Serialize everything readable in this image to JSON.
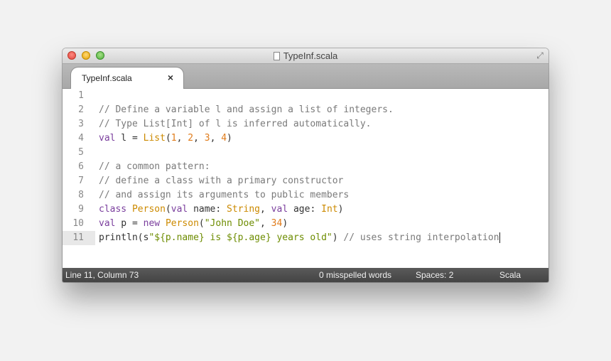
{
  "window": {
    "title": "TypeInf.scala"
  },
  "tab": {
    "label": "TypeInf.scala",
    "close_glyph": "×"
  },
  "editor": {
    "active_line": 11,
    "lines": [
      {
        "num": "1",
        "tokens": []
      },
      {
        "num": "2",
        "tokens": [
          {
            "t": "cm",
            "v": "// Define a variable l and assign a list of integers."
          }
        ]
      },
      {
        "num": "3",
        "tokens": [
          {
            "t": "cm",
            "v": "// Type List[Int] of l is inferred automatically."
          }
        ]
      },
      {
        "num": "4",
        "tokens": [
          {
            "t": "kw",
            "v": "val"
          },
          {
            "t": "",
            "v": " l = "
          },
          {
            "t": "ty",
            "v": "List"
          },
          {
            "t": "",
            "v": "("
          },
          {
            "t": "nu",
            "v": "1"
          },
          {
            "t": "",
            "v": ", "
          },
          {
            "t": "nu",
            "v": "2"
          },
          {
            "t": "",
            "v": ", "
          },
          {
            "t": "nu",
            "v": "3"
          },
          {
            "t": "",
            "v": ", "
          },
          {
            "t": "nu",
            "v": "4"
          },
          {
            "t": "",
            "v": ")"
          }
        ]
      },
      {
        "num": "5",
        "tokens": []
      },
      {
        "num": "6",
        "tokens": [
          {
            "t": "cm",
            "v": "// a common pattern:"
          }
        ]
      },
      {
        "num": "7",
        "tokens": [
          {
            "t": "cm",
            "v": "// define a class with a primary constructor"
          }
        ]
      },
      {
        "num": "8",
        "tokens": [
          {
            "t": "cm",
            "v": "// and assign its arguments to public members"
          }
        ]
      },
      {
        "num": "9",
        "tokens": [
          {
            "t": "kw",
            "v": "class"
          },
          {
            "t": "",
            "v": " "
          },
          {
            "t": "ty",
            "v": "Person"
          },
          {
            "t": "",
            "v": "("
          },
          {
            "t": "kw",
            "v": "val"
          },
          {
            "t": "",
            "v": " name: "
          },
          {
            "t": "ty",
            "v": "String"
          },
          {
            "t": "",
            "v": ", "
          },
          {
            "t": "kw",
            "v": "val"
          },
          {
            "t": "",
            "v": " age: "
          },
          {
            "t": "ty",
            "v": "Int"
          },
          {
            "t": "",
            "v": ")"
          }
        ]
      },
      {
        "num": "10",
        "tokens": [
          {
            "t": "kw",
            "v": "val"
          },
          {
            "t": "",
            "v": " p = "
          },
          {
            "t": "kw",
            "v": "new"
          },
          {
            "t": "",
            "v": " "
          },
          {
            "t": "ty",
            "v": "Person"
          },
          {
            "t": "",
            "v": "("
          },
          {
            "t": "st",
            "v": "\"John Doe\""
          },
          {
            "t": "",
            "v": ", "
          },
          {
            "t": "nu",
            "v": "34"
          },
          {
            "t": "",
            "v": ")"
          }
        ]
      },
      {
        "num": "11",
        "tokens": [
          {
            "t": "",
            "v": "println(s"
          },
          {
            "t": "st",
            "v": "\"${p.name} is ${p.age} years old\""
          },
          {
            "t": "",
            "v": ") "
          },
          {
            "t": "cm",
            "v": "// uses string interpolation"
          }
        ]
      }
    ]
  },
  "status": {
    "position": "Line 11, Column 73",
    "spelling": "0 misspelled words",
    "indent": "Spaces: 2",
    "syntax": "Scala"
  },
  "icons": {
    "close": "close-window-icon",
    "minimize": "minimize-window-icon",
    "zoom": "zoom-window-icon",
    "document": "document-icon",
    "fullscreen": "fullscreen-icon"
  },
  "colors": {
    "comment": "#7a7a7a",
    "keyword": "#7a3e9d",
    "type": "#cc8a00",
    "number": "#e07b1a",
    "string": "#6d8c00"
  }
}
